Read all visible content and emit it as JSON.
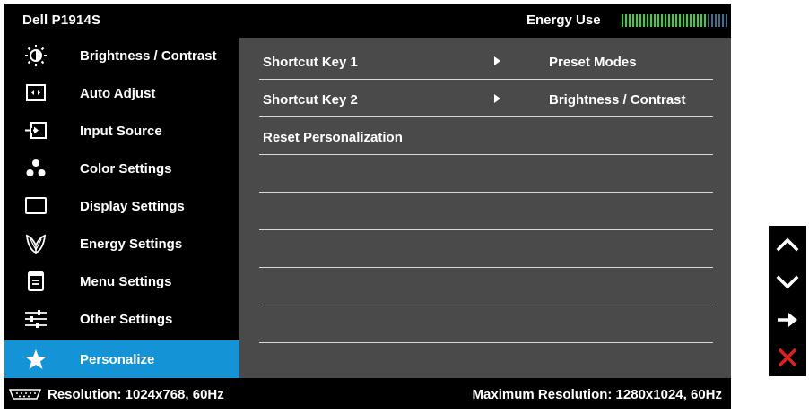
{
  "header": {
    "model": "Dell P1914S",
    "energy_label": "Energy Use",
    "energy_level": 0.8
  },
  "sidebar": {
    "items": [
      {
        "label": "Brightness / Contrast",
        "icon": "brightness-icon",
        "active": false
      },
      {
        "label": "Auto Adjust",
        "icon": "auto-adjust-icon",
        "active": false
      },
      {
        "label": "Input Source",
        "icon": "input-source-icon",
        "active": false
      },
      {
        "label": "Color Settings",
        "icon": "color-settings-icon",
        "active": false
      },
      {
        "label": "Display Settings",
        "icon": "display-settings-icon",
        "active": false
      },
      {
        "label": "Energy Settings",
        "icon": "energy-leaf-icon",
        "active": false
      },
      {
        "label": "Menu Settings",
        "icon": "menu-settings-icon",
        "active": false
      },
      {
        "label": "Other Settings",
        "icon": "other-settings-icon",
        "active": false
      },
      {
        "label": "Personalize",
        "icon": "star-icon",
        "active": true
      }
    ]
  },
  "main": {
    "rows": [
      {
        "label": "Shortcut Key 1",
        "value": "Preset Modes",
        "has_arrow": true
      },
      {
        "label": "Shortcut Key 2",
        "value": "Brightness / Contrast",
        "has_arrow": true
      },
      {
        "label": "Reset Personalization",
        "value": "",
        "has_arrow": false
      },
      {
        "label": "",
        "value": "",
        "has_arrow": false
      },
      {
        "label": "",
        "value": "",
        "has_arrow": false
      },
      {
        "label": "",
        "value": "",
        "has_arrow": false
      },
      {
        "label": "",
        "value": "",
        "has_arrow": false
      },
      {
        "label": "",
        "value": "",
        "has_arrow": false
      }
    ]
  },
  "footer": {
    "resolution": "Resolution: 1024x768,  60Hz",
    "max_resolution": "Maximum Resolution: 1280x1024,  60Hz"
  },
  "nav_buttons": [
    {
      "icon": "up-arrow-icon"
    },
    {
      "icon": "down-arrow-icon"
    },
    {
      "icon": "right-arrow-icon"
    },
    {
      "icon": "close-icon"
    }
  ],
  "colors": {
    "highlight": "#1493d6",
    "panel": "#4a4a4a",
    "energy_on": "#37d237",
    "energy_off": "#3f6f8f",
    "exit": "#e0201c"
  }
}
